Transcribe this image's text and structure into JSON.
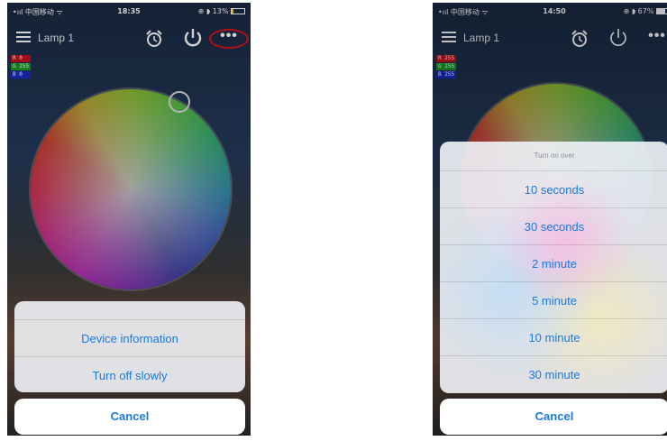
{
  "left_phone": {
    "status": {
      "carrier": "•ııl 中国移动 ᯤ",
      "time": "18:35",
      "battery_text": "⊕ ◗ 13%",
      "battery_level": 0.13
    },
    "nav": {
      "title": "Lamp 1",
      "menu_icon": "hamburger-icon",
      "alarm_icon": "alarm-icon",
      "power_icon": "power-icon",
      "more_label": "•••"
    },
    "rgb": {
      "r": "R 0",
      "g": "G 255",
      "b": "B 0"
    },
    "action_sheet": {
      "items": [
        "Device information",
        "Turn off slowly"
      ],
      "cancel": "Cancel"
    }
  },
  "right_phone": {
    "status": {
      "carrier": "•ııl 中国移动 ᯤ",
      "time": "14:50",
      "battery_text": "⊕ ◗ 67%",
      "battery_level": 0.67
    },
    "nav": {
      "title": "Lamp 1",
      "more_label": "•••"
    },
    "rgb": {
      "r": "R 255",
      "g": "G 255",
      "b": "B 255"
    },
    "action_sheet": {
      "header": "Turn on over",
      "items": [
        "10 seconds",
        "30 seconds",
        "2 minute",
        "5 minute",
        "10 minute",
        "30 minute"
      ],
      "cancel": "Cancel"
    }
  },
  "colors": {
    "accent_blue": "#1a7ae0",
    "highlight_red": "#e0101a"
  }
}
